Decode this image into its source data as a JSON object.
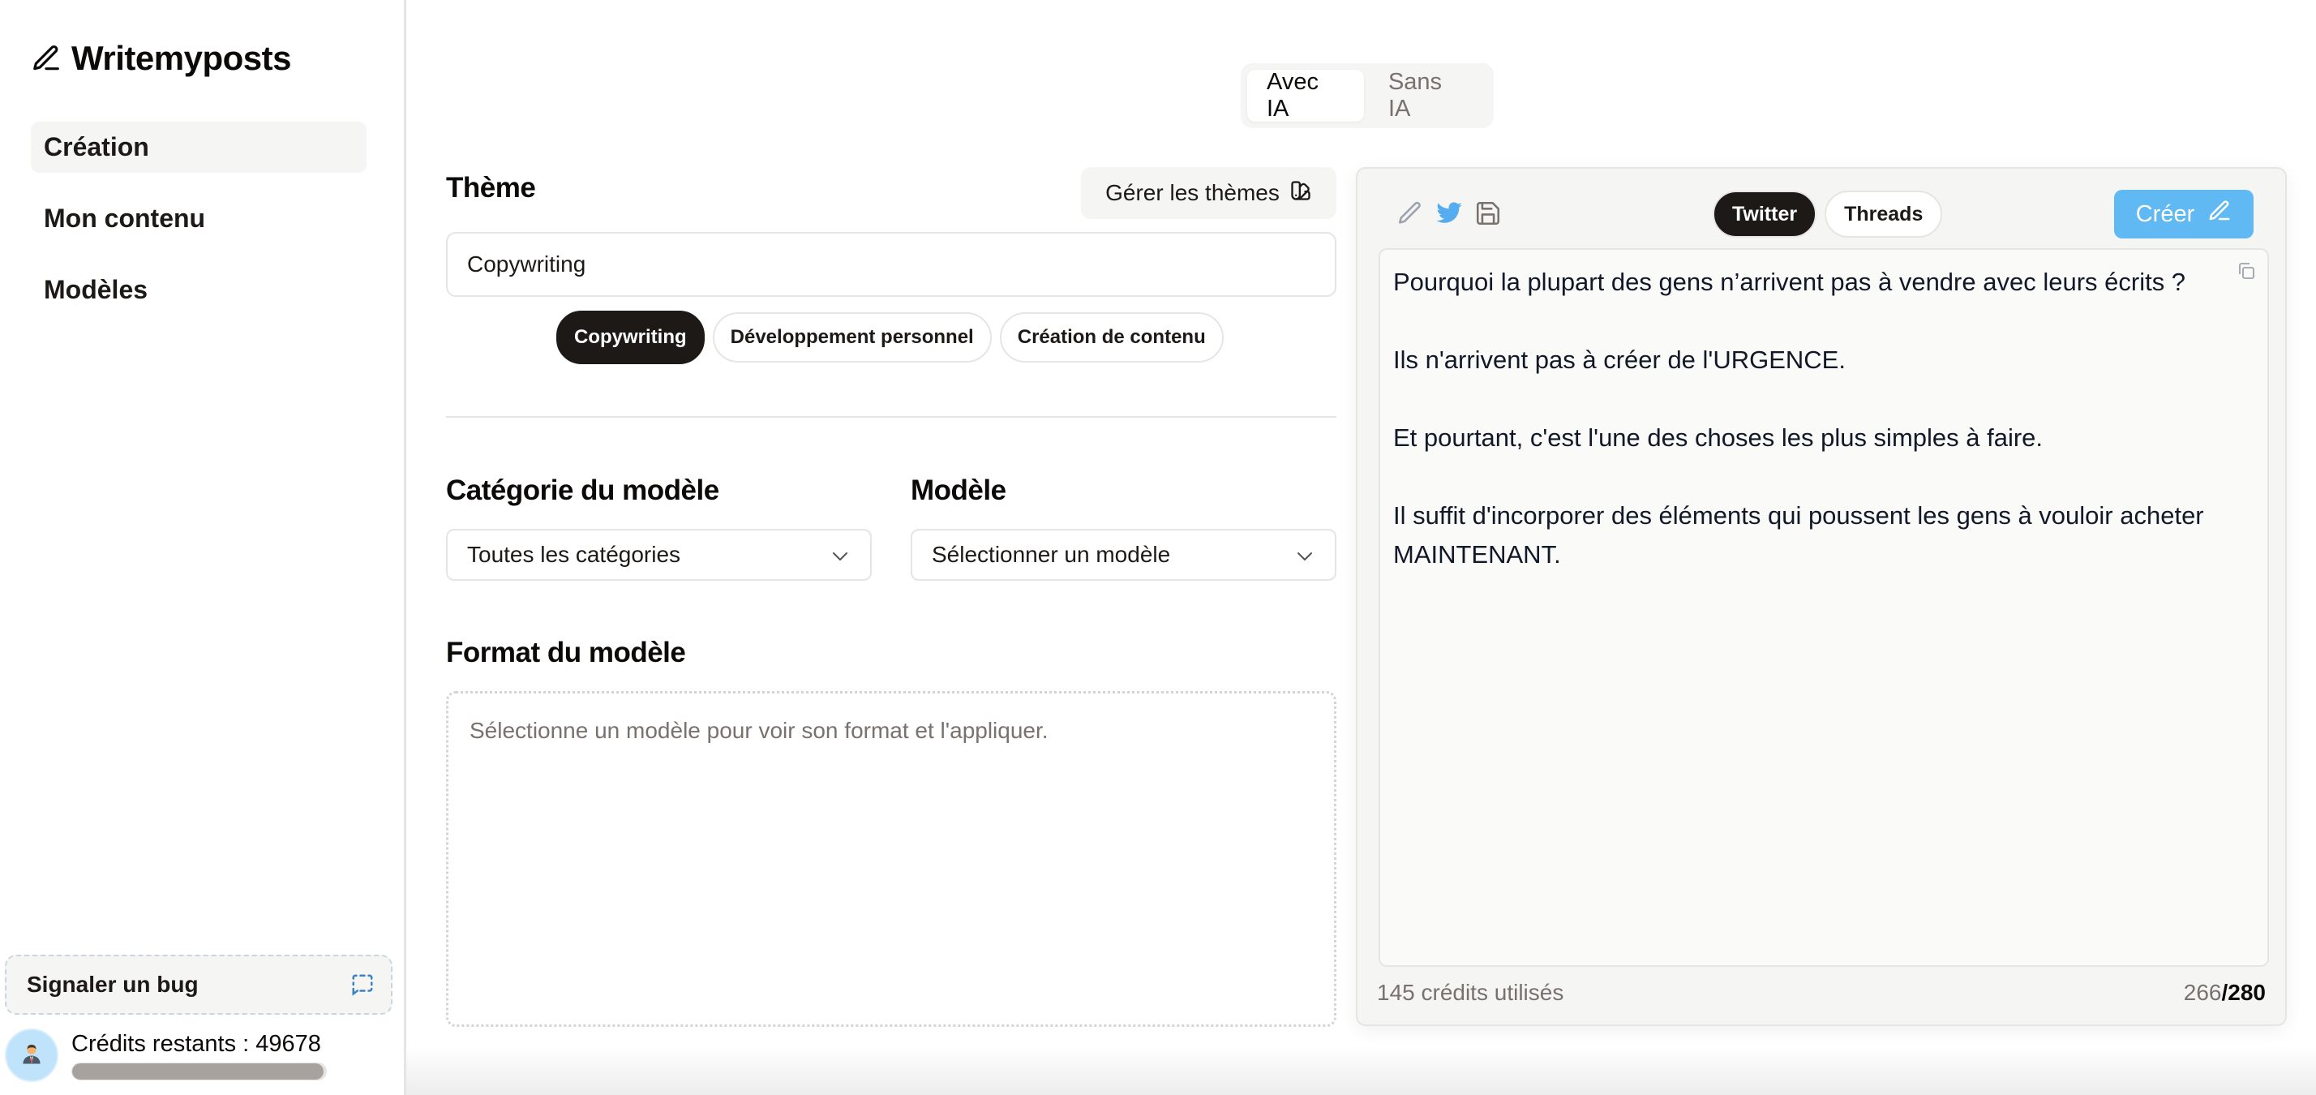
{
  "app": {
    "name": "Writemyposts",
    "logo_icon": "pencil-line-icon"
  },
  "sidebar": {
    "items": [
      {
        "label": "Création",
        "active": true
      },
      {
        "label": "Mon contenu",
        "active": false
      },
      {
        "label": "Modèles",
        "active": false
      }
    ],
    "bug_report": {
      "label": "Signaler un bug",
      "icon": "message-square-dashed-icon"
    },
    "credits": {
      "label": "Crédits restants : 49678",
      "remaining": 49678,
      "progress_percent": 99,
      "avatar_icon": "businessman-avatar-icon"
    }
  },
  "mode_toggle": {
    "options": [
      {
        "label": "Avec IA",
        "active": true
      },
      {
        "label": "Sans IA",
        "active": false
      }
    ]
  },
  "theme": {
    "label": "Thème",
    "manage_button": {
      "label": "Gérer les thèmes",
      "icon": "swatch-book-icon"
    },
    "input_value": "Copywriting",
    "chips": [
      {
        "label": "Copywriting",
        "active": true
      },
      {
        "label": "Développement personnel",
        "active": false
      },
      {
        "label": "Création de contenu",
        "active": false
      }
    ]
  },
  "model_category": {
    "label": "Catégorie du modèle",
    "selected": "Toutes les catégories"
  },
  "model": {
    "label": "Modèle",
    "selected": "Sélectionner un modèle"
  },
  "format": {
    "label": "Format du modèle",
    "placeholder": "Sélectionne un modèle pour voir son format et l'appliquer."
  },
  "editor_panel": {
    "tool_icons": [
      "pencil-icon",
      "twitter-icon",
      "save-icon"
    ],
    "platform_tabs": [
      {
        "label": "Twitter",
        "active": true
      },
      {
        "label": "Threads",
        "active": false
      }
    ],
    "create_button": {
      "label": "Créer",
      "icon": "pencil-line-icon"
    },
    "content": "Pourquoi la plupart des gens n’arrivent pas à vendre avec leurs écrits ?\n\nIls n'arrivent pas à créer de l'URGENCE.\n\nEt pourtant, c'est l'une des choses les plus simples à faire.\n\nIl suffit d'incorporer des éléments qui poussent les gens à vouloir acheter MAINTENANT.",
    "credits_used": "145 crédits utilisés",
    "char_count": "266",
    "char_separator": "/",
    "char_limit": "280"
  },
  "colors": {
    "accent_blue": "#60b9f2",
    "twitter_blue": "#55acee",
    "dark": "#1c1917",
    "muted": "#78716c",
    "surface": "#f5f5f4"
  }
}
